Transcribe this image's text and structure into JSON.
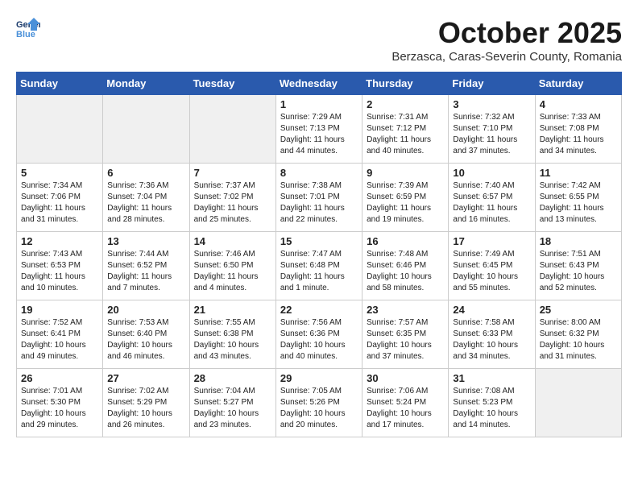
{
  "header": {
    "logo_line1": "General",
    "logo_line2": "Blue",
    "title": "October 2025",
    "subtitle": "Berzasca, Caras-Severin County, Romania"
  },
  "weekdays": [
    "Sunday",
    "Monday",
    "Tuesday",
    "Wednesday",
    "Thursday",
    "Friday",
    "Saturday"
  ],
  "weeks": [
    [
      {
        "day": "",
        "text": "",
        "shaded": true
      },
      {
        "day": "",
        "text": "",
        "shaded": true
      },
      {
        "day": "",
        "text": "",
        "shaded": true
      },
      {
        "day": "1",
        "text": "Sunrise: 7:29 AM\nSunset: 7:13 PM\nDaylight: 11 hours\nand 44 minutes.",
        "shaded": false
      },
      {
        "day": "2",
        "text": "Sunrise: 7:31 AM\nSunset: 7:12 PM\nDaylight: 11 hours\nand 40 minutes.",
        "shaded": false
      },
      {
        "day": "3",
        "text": "Sunrise: 7:32 AM\nSunset: 7:10 PM\nDaylight: 11 hours\nand 37 minutes.",
        "shaded": false
      },
      {
        "day": "4",
        "text": "Sunrise: 7:33 AM\nSunset: 7:08 PM\nDaylight: 11 hours\nand 34 minutes.",
        "shaded": false
      }
    ],
    [
      {
        "day": "5",
        "text": "Sunrise: 7:34 AM\nSunset: 7:06 PM\nDaylight: 11 hours\nand 31 minutes.",
        "shaded": false
      },
      {
        "day": "6",
        "text": "Sunrise: 7:36 AM\nSunset: 7:04 PM\nDaylight: 11 hours\nand 28 minutes.",
        "shaded": false
      },
      {
        "day": "7",
        "text": "Sunrise: 7:37 AM\nSunset: 7:02 PM\nDaylight: 11 hours\nand 25 minutes.",
        "shaded": false
      },
      {
        "day": "8",
        "text": "Sunrise: 7:38 AM\nSunset: 7:01 PM\nDaylight: 11 hours\nand 22 minutes.",
        "shaded": false
      },
      {
        "day": "9",
        "text": "Sunrise: 7:39 AM\nSunset: 6:59 PM\nDaylight: 11 hours\nand 19 minutes.",
        "shaded": false
      },
      {
        "day": "10",
        "text": "Sunrise: 7:40 AM\nSunset: 6:57 PM\nDaylight: 11 hours\nand 16 minutes.",
        "shaded": false
      },
      {
        "day": "11",
        "text": "Sunrise: 7:42 AM\nSunset: 6:55 PM\nDaylight: 11 hours\nand 13 minutes.",
        "shaded": false
      }
    ],
    [
      {
        "day": "12",
        "text": "Sunrise: 7:43 AM\nSunset: 6:53 PM\nDaylight: 11 hours\nand 10 minutes.",
        "shaded": false
      },
      {
        "day": "13",
        "text": "Sunrise: 7:44 AM\nSunset: 6:52 PM\nDaylight: 11 hours\nand 7 minutes.",
        "shaded": false
      },
      {
        "day": "14",
        "text": "Sunrise: 7:46 AM\nSunset: 6:50 PM\nDaylight: 11 hours\nand 4 minutes.",
        "shaded": false
      },
      {
        "day": "15",
        "text": "Sunrise: 7:47 AM\nSunset: 6:48 PM\nDaylight: 11 hours\nand 1 minute.",
        "shaded": false
      },
      {
        "day": "16",
        "text": "Sunrise: 7:48 AM\nSunset: 6:46 PM\nDaylight: 10 hours\nand 58 minutes.",
        "shaded": false
      },
      {
        "day": "17",
        "text": "Sunrise: 7:49 AM\nSunset: 6:45 PM\nDaylight: 10 hours\nand 55 minutes.",
        "shaded": false
      },
      {
        "day": "18",
        "text": "Sunrise: 7:51 AM\nSunset: 6:43 PM\nDaylight: 10 hours\nand 52 minutes.",
        "shaded": false
      }
    ],
    [
      {
        "day": "19",
        "text": "Sunrise: 7:52 AM\nSunset: 6:41 PM\nDaylight: 10 hours\nand 49 minutes.",
        "shaded": false
      },
      {
        "day": "20",
        "text": "Sunrise: 7:53 AM\nSunset: 6:40 PM\nDaylight: 10 hours\nand 46 minutes.",
        "shaded": false
      },
      {
        "day": "21",
        "text": "Sunrise: 7:55 AM\nSunset: 6:38 PM\nDaylight: 10 hours\nand 43 minutes.",
        "shaded": false
      },
      {
        "day": "22",
        "text": "Sunrise: 7:56 AM\nSunset: 6:36 PM\nDaylight: 10 hours\nand 40 minutes.",
        "shaded": false
      },
      {
        "day": "23",
        "text": "Sunrise: 7:57 AM\nSunset: 6:35 PM\nDaylight: 10 hours\nand 37 minutes.",
        "shaded": false
      },
      {
        "day": "24",
        "text": "Sunrise: 7:58 AM\nSunset: 6:33 PM\nDaylight: 10 hours\nand 34 minutes.",
        "shaded": false
      },
      {
        "day": "25",
        "text": "Sunrise: 8:00 AM\nSunset: 6:32 PM\nDaylight: 10 hours\nand 31 minutes.",
        "shaded": false
      }
    ],
    [
      {
        "day": "26",
        "text": "Sunrise: 7:01 AM\nSunset: 5:30 PM\nDaylight: 10 hours\nand 29 minutes.",
        "shaded": false
      },
      {
        "day": "27",
        "text": "Sunrise: 7:02 AM\nSunset: 5:29 PM\nDaylight: 10 hours\nand 26 minutes.",
        "shaded": false
      },
      {
        "day": "28",
        "text": "Sunrise: 7:04 AM\nSunset: 5:27 PM\nDaylight: 10 hours\nand 23 minutes.",
        "shaded": false
      },
      {
        "day": "29",
        "text": "Sunrise: 7:05 AM\nSunset: 5:26 PM\nDaylight: 10 hours\nand 20 minutes.",
        "shaded": false
      },
      {
        "day": "30",
        "text": "Sunrise: 7:06 AM\nSunset: 5:24 PM\nDaylight: 10 hours\nand 17 minutes.",
        "shaded": false
      },
      {
        "day": "31",
        "text": "Sunrise: 7:08 AM\nSunset: 5:23 PM\nDaylight: 10 hours\nand 14 minutes.",
        "shaded": false
      },
      {
        "day": "",
        "text": "",
        "shaded": true
      }
    ]
  ]
}
